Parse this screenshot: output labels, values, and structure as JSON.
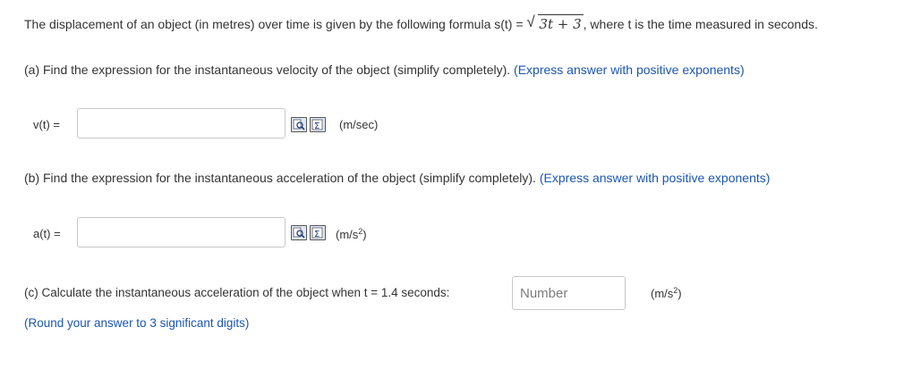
{
  "intro": {
    "before": "The displacement of an object (in metres) over time is given by the following formula s(t) = ",
    "formula": "3t + 3",
    "after": ", where t is the time measured in seconds."
  },
  "part_a": {
    "text": "(a) Find the expression for the instantaneous velocity of the object (simplify completely). ",
    "hint": "(Express answer with positive exponents)",
    "label": "v(t) =",
    "value": "",
    "unit": "(m/sec)"
  },
  "part_b": {
    "text": "(b) Find the expression for the instantaneous acceleration of the object (simplify completely). ",
    "hint": "(Express answer with positive exponents)",
    "label": "a(t) =",
    "value": "",
    "unit_base": "(m/s",
    "unit_exp": "2",
    "unit_end": ")"
  },
  "part_c": {
    "text": "(c) Calculate the instantaneous acceleration of the object when t = 1.4 seconds:",
    "placeholder": "Number",
    "value": "",
    "unit_base": "(m/s",
    "unit_exp": "2",
    "unit_end": ")",
    "round_hint": "(Round your answer to 3 significant digits)"
  },
  "tools": {
    "preview_icon": "magnifier-preview-icon",
    "equation_icon": "sigma-equation-editor-icon"
  },
  "colors": {
    "hint": "#1a55b5",
    "text": "#333333",
    "border": "#c8c8c8"
  }
}
